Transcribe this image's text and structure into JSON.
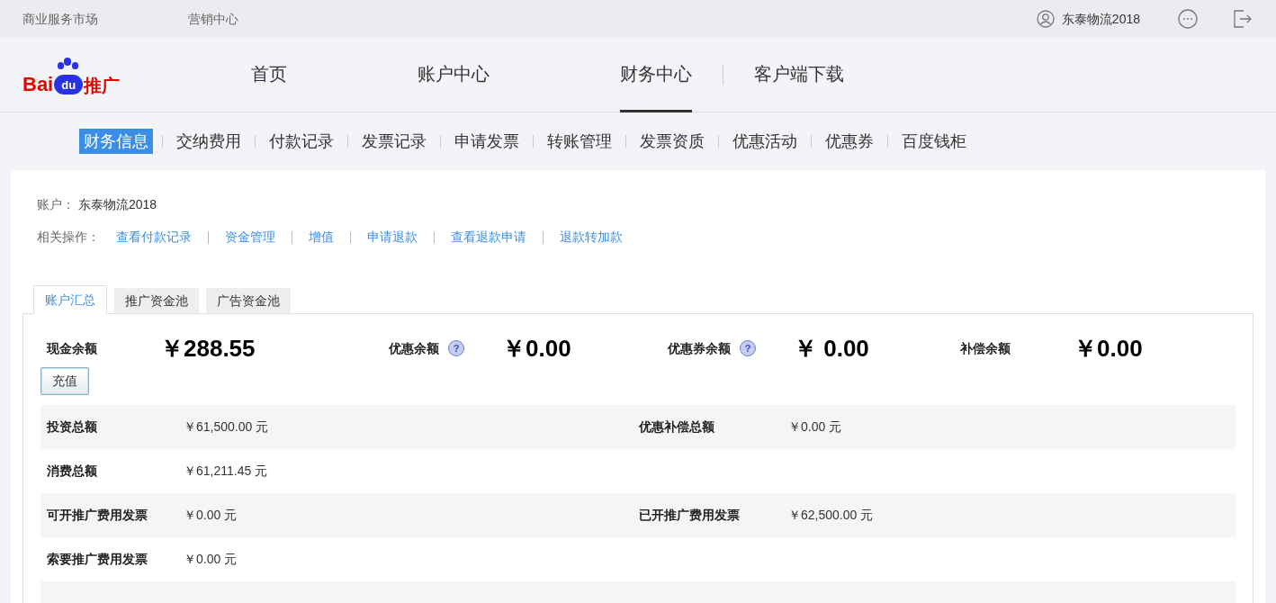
{
  "top_bar": {
    "links": [
      "商业服务市场",
      "营销中心"
    ],
    "user": "东泰物流2018"
  },
  "logo": {
    "text": "Bai",
    "badge": "du",
    "suffix": "推广"
  },
  "main_nav": [
    {
      "label": "首页",
      "selected": false
    },
    {
      "label": "账户中心",
      "selected": false
    },
    {
      "label": "财务中心",
      "selected": true
    },
    {
      "label": "客户端下载",
      "selected": false
    }
  ],
  "sub_nav": [
    {
      "label": "财务信息",
      "selected": true
    },
    {
      "label": "交纳费用",
      "selected": false
    },
    {
      "label": "付款记录",
      "selected": false
    },
    {
      "label": "发票记录",
      "selected": false
    },
    {
      "label": "申请发票",
      "selected": false
    },
    {
      "label": "转账管理",
      "selected": false
    },
    {
      "label": "发票资质",
      "selected": false
    },
    {
      "label": "优惠活动",
      "selected": false
    },
    {
      "label": "优惠券",
      "selected": false
    },
    {
      "label": "百度钱柜",
      "selected": false
    }
  ],
  "account": {
    "label": "账户：",
    "value": "东泰物流2018"
  },
  "operations": {
    "label": "相关操作：",
    "links": [
      "查看付款记录",
      "资金管理",
      "增值",
      "申请退款",
      "查看退款申请",
      "退款转加款"
    ]
  },
  "tabs": [
    {
      "label": "账户汇总",
      "selected": true
    },
    {
      "label": "推广资金池",
      "selected": false
    },
    {
      "label": "广告资金池",
      "selected": false
    }
  ],
  "balances": [
    {
      "label": "现金余额",
      "amount": "￥288.55"
    },
    {
      "label": "优惠余额",
      "help": "?",
      "amount": "￥0.00"
    },
    {
      "label": "优惠券余额",
      "help": "?",
      "amount": "￥ 0.00"
    },
    {
      "label": "补偿余额",
      "amount": "￥0.00"
    }
  ],
  "recharge_button": "充值",
  "summary_rows": [
    {
      "left_label": "投资总额",
      "left_value": "￥61,500.00 元",
      "right_label": "优惠补偿总额",
      "right_value": "￥0.00 元"
    },
    {
      "left_label": "消费总额",
      "left_value": "￥61,211.45 元"
    },
    {
      "left_label": "可开推广费用发票",
      "left_value": "￥0.00 元",
      "right_label": "已开推广费用发票",
      "right_value": "￥62,500.00 元"
    },
    {
      "left_label": "索要推广费用发票",
      "left_value": "￥0.00 元"
    }
  ]
}
